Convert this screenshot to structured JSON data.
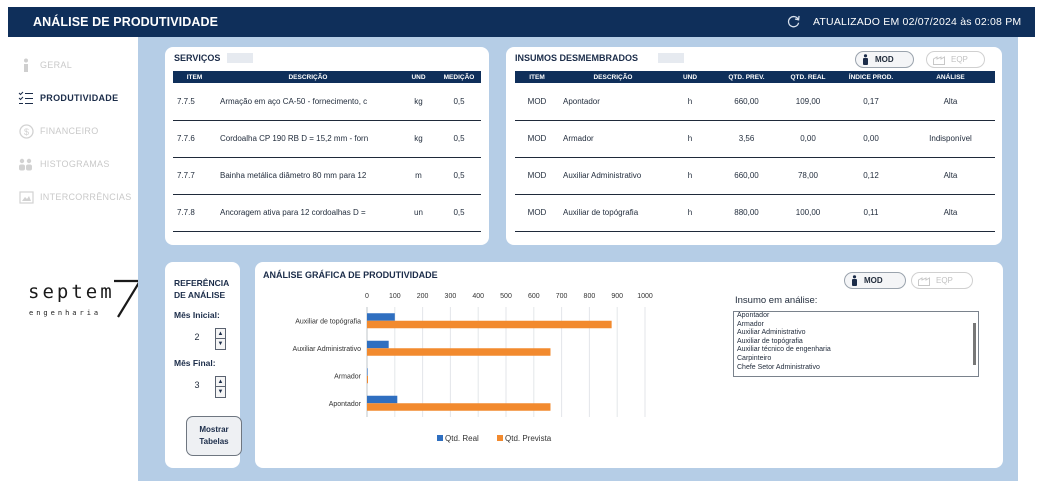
{
  "header": {
    "title": "ANÁLISE DE PRODUTIVIDADE",
    "updated": "ATUALIZADO EM 02/07/2024 às 02:08 PM"
  },
  "sidebar": {
    "items": [
      {
        "label": "GERAL",
        "icon": "info-icon"
      },
      {
        "label": "PRODUTIVIDADE",
        "icon": "checklist-icon"
      },
      {
        "label": "FINANCEIRO",
        "icon": "money-icon"
      },
      {
        "label": "HISTOGRAMAS",
        "icon": "people-icon"
      },
      {
        "label": "INTERCORRÊNCIAS",
        "icon": "image-icon"
      }
    ],
    "active": "PRODUTIVIDADE"
  },
  "logo": {
    "word": "septem",
    "mark": "7",
    "sub": "engenharia"
  },
  "servicos": {
    "title": "SERVIÇOS",
    "headers": [
      "ITEM",
      "DESCRIÇÃO",
      "UND",
      "MEDIÇÃO"
    ],
    "rows": [
      [
        "7.7.5",
        "Armação em aço CA-50 - fornecimento, c",
        "kg",
        "0,5"
      ],
      [
        "7.7.6",
        "Cordoalha CP 190 RB D = 15,2 mm - forn",
        "kg",
        "0,5"
      ],
      [
        "7.7.7",
        "Bainha metálica diâmetro 80 mm para 12",
        "m",
        "0,5"
      ],
      [
        "7.7.8",
        "Ancoragem ativa para 12 cordoalhas D =",
        "un",
        "0,5"
      ]
    ]
  },
  "insumos": {
    "title": "INSUMOS DESMEMBRADOS",
    "buttons": {
      "mod": "MOD",
      "eqp": "EQP"
    },
    "headers": [
      "ITEM",
      "DESCRIÇÃO",
      "UND",
      "QTD. PREV.",
      "QTD. REAL",
      "ÍNDICE PROD.",
      "ANÁLISE"
    ],
    "rows": [
      [
        "MOD",
        "Apontador",
        "h",
        "660,00",
        "109,00",
        "0,17",
        "Alta"
      ],
      [
        "MOD",
        "Armador",
        "h",
        "3,56",
        "0,00",
        "0,00",
        "Indisponível"
      ],
      [
        "MOD",
        "Auxiliar Administrativo",
        "h",
        "660,00",
        "78,00",
        "0,12",
        "Alta"
      ],
      [
        "MOD",
        "Auxiliar de topógrafia",
        "h",
        "880,00",
        "100,00",
        "0,11",
        "Alta"
      ]
    ]
  },
  "referencia": {
    "title_line1": "REFERÊNCIA",
    "title_line2": "DE ANÁLISE",
    "mes_inicial_label": "Mês Inicial:",
    "mes_inicial": "2",
    "mes_final_label": "Mês Final:",
    "mes_final": "3",
    "show_button_line1": "Mostrar",
    "show_button_line2": "Tabelas"
  },
  "grafico": {
    "title": "ANÁLISE GRÁFICA DE PRODUTIVIDADE",
    "buttons": {
      "mod": "MOD",
      "eqp": "EQP"
    },
    "insumo_label": "Insumo em análise:",
    "insumo_options": [
      "Apontador",
      "Armador",
      "Auxiliar Administrativo",
      "Auxiliar de topógrafia",
      "Auxiliar técnico de engenharia",
      "Carpinteiro",
      "Chefe Setor Administrativo"
    ]
  },
  "colors": {
    "navy": "#0f2f5a",
    "background": "#b5cde6",
    "real": "#2f6fc0",
    "prevista": "#f28a2e"
  },
  "chart_data": {
    "type": "bar",
    "orientation": "horizontal",
    "categories": [
      "Auxiliar de topógrafia",
      "Auxiliar Administrativo",
      "Armador",
      "Apontador"
    ],
    "series": [
      {
        "name": "Qtd. Real",
        "values": [
          100,
          78,
          0,
          109
        ],
        "color": "#2f6fc0"
      },
      {
        "name": "Qtd. Prevista",
        "values": [
          880,
          660,
          3.56,
          660
        ],
        "color": "#f28a2e"
      }
    ],
    "xticks": [
      "0",
      "100",
      "200",
      "300",
      "400",
      "500",
      "600",
      "700",
      "800",
      "900",
      "1000"
    ],
    "xlim": [
      0,
      1000
    ],
    "grid": true,
    "legend": "bottom"
  }
}
